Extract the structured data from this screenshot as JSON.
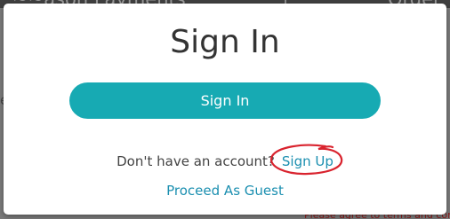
{
  "background": {
    "header_left_text": "~~ason Payments",
    "header_right_text": "Order",
    "side_left_text": "e",
    "footer_text": "Please agree to terms and condi"
  },
  "modal": {
    "title": "Sign In",
    "signin_button_label": "Sign In",
    "no_account_text": "Don't have an account?",
    "signup_link": "Sign Up",
    "guest_link": "Proceed As Guest"
  },
  "colors": {
    "accent": "#17aab3",
    "link": "#1b8fb0",
    "annotation": "#d9232e"
  }
}
